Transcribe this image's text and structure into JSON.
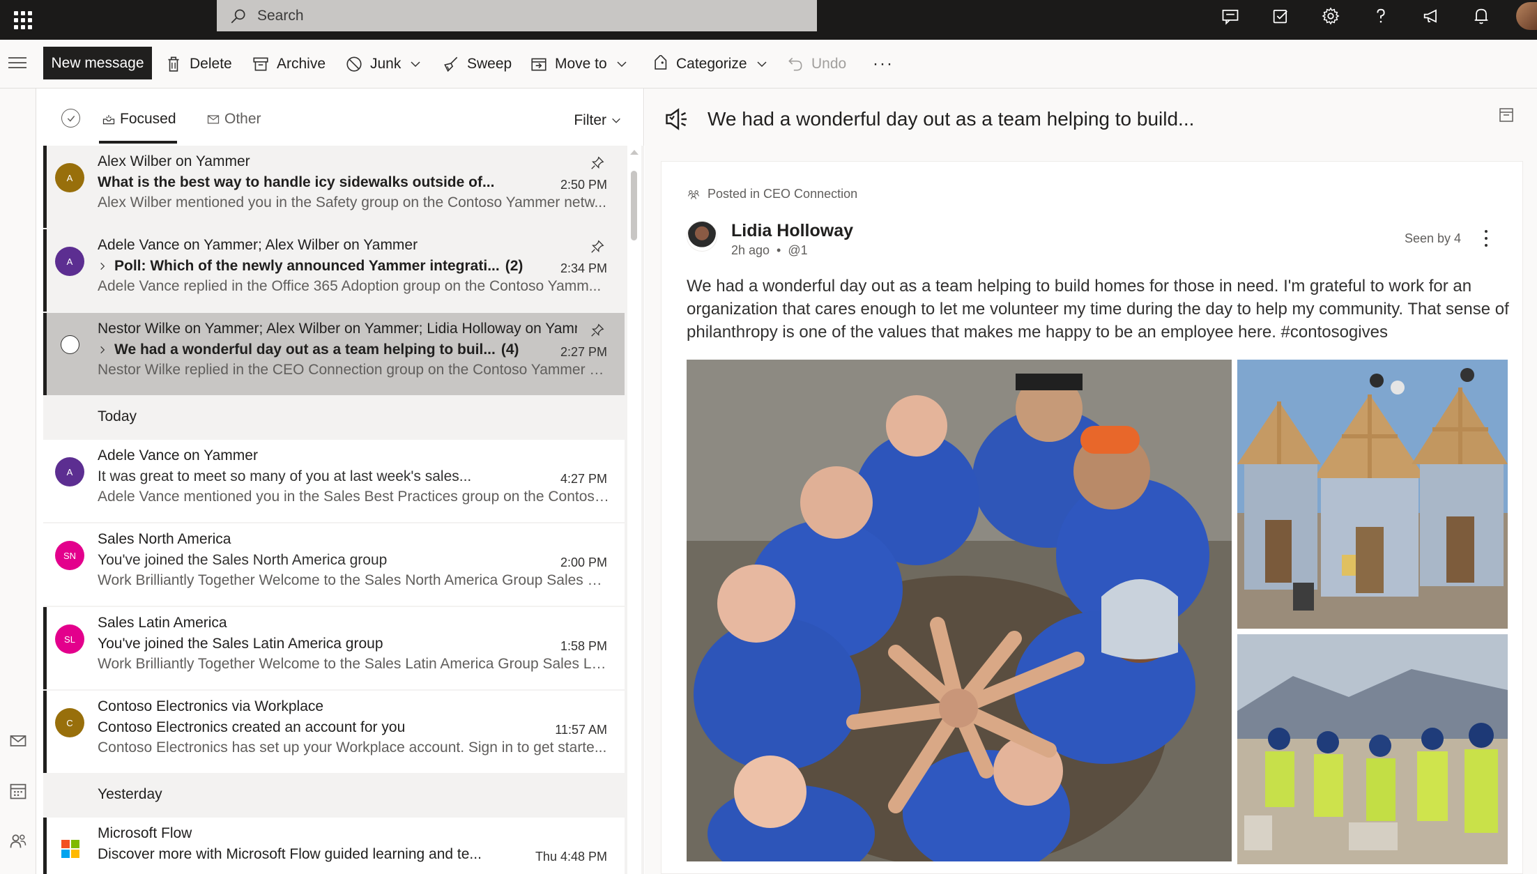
{
  "header": {
    "search_placeholder": "Search"
  },
  "toolbar": {
    "new_message": "New message",
    "delete": "Delete",
    "archive": "Archive",
    "junk": "Junk",
    "sweep": "Sweep",
    "move_to": "Move to",
    "categorize": "Categorize",
    "undo": "Undo",
    "more": "···"
  },
  "list": {
    "tabs": {
      "focused": "Focused",
      "other": "Other"
    },
    "filter": "Filter",
    "sections": {
      "today": "Today",
      "yesterday": "Yesterday"
    },
    "items": [
      {
        "sender": "Alex Wilber on Yammer",
        "subject": "What is the best way to handle icy sidewalks outside of...",
        "time": "2:50 PM",
        "preview": "Alex Wilber mentioned you in the Safety group on the Contoso Yammer netw...",
        "initial": "A",
        "avatar_color": "#986f0b"
      },
      {
        "sender": "Adele Vance on Yammer; Alex Wilber on Yammer",
        "subject": "Poll: Which of the newly announced Yammer integrati...",
        "thread_count": "(2)",
        "time": "2:34 PM",
        "preview": "Adele Vance replied in the Office 365 Adoption group on the Contoso Yamm...",
        "initial": "A",
        "avatar_color": "#5c2e91"
      },
      {
        "sender": "Nestor Wilke on Yammer; Alex Wilber on Yammer; Lidia Holloway on Yammer",
        "subject": "We had a wonderful day out as a team helping to buil...",
        "thread_count": "(4)",
        "time": "2:27 PM",
        "preview": "Nestor Wilke replied in the CEO Connection group on the Contoso Yammer n..."
      },
      {
        "sender": "Adele Vance on Yammer",
        "subject": "It was great to meet so many of you at last week's sales...",
        "time": "4:27 PM",
        "preview": "Adele Vance mentioned you in the Sales Best Practices group on the Contoso...",
        "initial": "A",
        "avatar_color": "#5c2e91"
      },
      {
        "sender": "Sales North America",
        "subject": "You've joined the Sales North America group",
        "time": "2:00 PM",
        "preview": "Work Brilliantly Together Welcome to the Sales North America Group Sales N...",
        "initial": "SN",
        "avatar_color": "#e3008c"
      },
      {
        "sender": "Sales Latin America",
        "subject": "You've joined the Sales Latin America group",
        "time": "1:58 PM",
        "preview": "Work Brilliantly Together Welcome to the Sales Latin America Group Sales Lat...",
        "initial": "SL",
        "avatar_color": "#e3008c"
      },
      {
        "sender": "Contoso Electronics via Workplace",
        "subject": "Contoso Electronics created an account for you",
        "time": "11:57 AM",
        "preview": "Contoso Electronics has set up your Workplace account. Sign in to get starte...",
        "initial": "C",
        "avatar_color": "#986f0b"
      },
      {
        "sender": "Microsoft Flow",
        "subject": "Discover more with Microsoft Flow guided learning and te...",
        "time": "Thu 4:48 PM"
      }
    ]
  },
  "reading": {
    "title": "We had a wonderful day out as a team helping to build...",
    "posted_in": "Posted in CEO Connection",
    "author": "Lidia Holloway",
    "meta": "2h ago  •  @1",
    "seen_by": "Seen by 4",
    "body": "We had a wonderful day out as a team helping to build homes for those in need. I'm grateful to work for an organization that cares enough to let me volunteer my time during the day to help my community. That sense of philanthropy is one of the values that makes me happy to be an employee here. #contosogives"
  }
}
